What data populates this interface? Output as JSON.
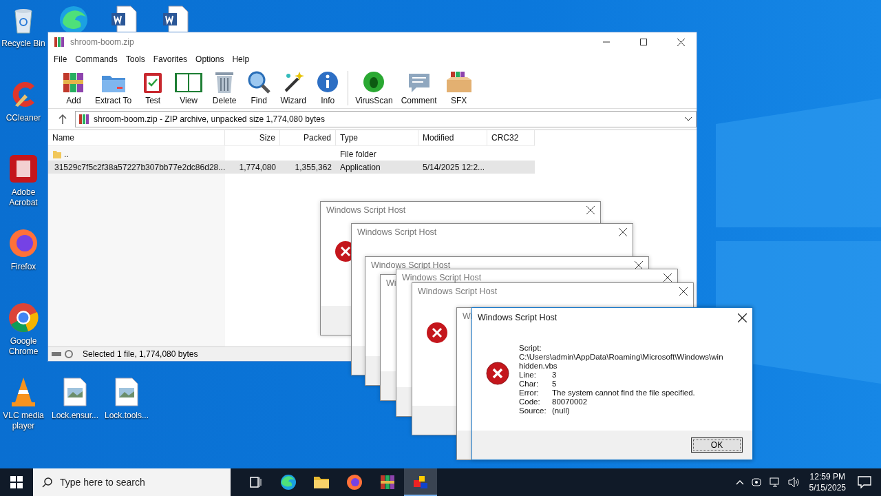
{
  "desktop_icons": [
    {
      "kind": "bin",
      "label": "Recycle Bin"
    },
    {
      "kind": "edge"
    },
    {
      "kind": "word"
    },
    {
      "kind": "word"
    },
    {
      "kind": "ccleaner",
      "label": "CCleaner"
    },
    {
      "kind": "acrobat",
      "label": "Adobe Acrobat"
    },
    {
      "kind": "firefox",
      "label": "Firefox"
    },
    {
      "kind": "chrome",
      "label": "Google Chrome"
    },
    {
      "kind": "vlc",
      "label": "VLC media player"
    },
    {
      "kind": "image",
      "label": "Lock.ensur..."
    },
    {
      "kind": "image",
      "label": "Lock.tools..."
    }
  ],
  "winrar": {
    "title": "shroom-boom.zip",
    "menu": [
      "File",
      "Commands",
      "Tools",
      "Favorites",
      "Options",
      "Help"
    ],
    "toolbar": [
      "Add",
      "Extract To",
      "Test",
      "View",
      "Delete",
      "Find",
      "Wizard",
      "Info",
      "VirusScan",
      "Comment",
      "SFX"
    ],
    "address": "shroom-boom.zip - ZIP archive, unpacked size 1,774,080 bytes",
    "columns": [
      "Name",
      "Size",
      "Packed",
      "Type",
      "Modified",
      "CRC32"
    ],
    "rows": [
      {
        "cells": [
          "..",
          "",
          "",
          "File folder",
          "",
          ""
        ],
        "kind": "folder",
        "selected": false
      },
      {
        "cells": [
          "31529c7f5c2f38a57227b307bb77e2dc86d28...",
          "1,774,080",
          "1,355,362",
          "Application",
          "5/14/2025 12:2...",
          ""
        ],
        "kind": "file",
        "selected": true
      }
    ],
    "status": "Selected 1 file, 1,774,080 bytes"
  },
  "back_dialogs": [
    {
      "title": "Windows Script Host",
      "icon": true,
      "close": true
    },
    {
      "title": "Windows Script Host",
      "close": true
    },
    {
      "title": "Windows Script Host",
      "close": true
    },
    {
      "title": "Wi"
    },
    {
      "title": "Windows Script Host",
      "close": true
    },
    {
      "title": "Windows Script Host",
      "icon": true,
      "close": true
    },
    {
      "title": "Wi"
    }
  ],
  "dialog": {
    "title": "Windows Script Host",
    "script_label": "Script:",
    "script_value": "C:\\Users\\admin\\AppData\\Roaming\\Microsoft\\Windows\\winhidden.vbs",
    "fields": [
      {
        "label": "Line:",
        "value": "3"
      },
      {
        "label": "Char:",
        "value": "5"
      },
      {
        "label": "Error:",
        "value": "The system cannot find the file specified."
      },
      {
        "label": "Code:",
        "value": "80070002"
      },
      {
        "label": "Source:",
        "value": "(null)"
      }
    ],
    "button": "OK"
  },
  "taskbar": {
    "search_placeholder": "Type here to search",
    "apps": [
      {
        "selected": false
      },
      {
        "selected": false
      },
      {
        "selected": false
      },
      {
        "selected": false
      },
      {
        "selected": false
      },
      {
        "selected": true
      }
    ],
    "time": "12:59 PM",
    "date": "5/15/2025"
  }
}
